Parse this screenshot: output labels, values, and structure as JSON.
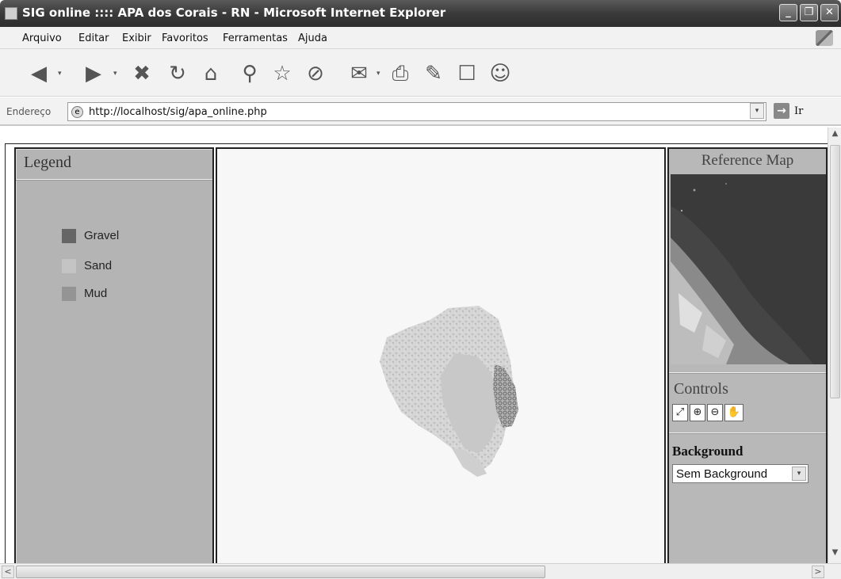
{
  "window": {
    "title": "SIG online :::: APA dos Corais - RN - Microsoft Internet Explorer",
    "minimize": "_",
    "maximize": "❐",
    "close": "✕"
  },
  "menu": [
    "Arquivo",
    "Editar",
    "Exibir",
    "Favoritos",
    "Ferramentas",
    "Ajuda"
  ],
  "toolbar": {
    "icons": [
      "back-icon",
      "forward-icon",
      "stop-icon",
      "refresh-icon",
      "home-icon",
      "search-icon",
      "favorites-icon",
      "history-icon",
      "mail-icon",
      "print-icon",
      "edit-icon",
      "discuss-icon",
      "messenger-icon"
    ],
    "glyphs": [
      "◀",
      "▶",
      "✖",
      "↻",
      "⌂",
      "⚲",
      "☆",
      "⊘",
      "✉",
      "⎙",
      "✎",
      "☐",
      "☺"
    ]
  },
  "address": {
    "label": "Endereço",
    "url": "http://localhost/sig/apa_online.php",
    "go_label": "Ir",
    "dropdown": "▾",
    "go_glyph": "→"
  },
  "legend": {
    "title": "Legend",
    "items": [
      {
        "label": "Gravel",
        "color": "#666666"
      },
      {
        "label": "Sand",
        "color": "#c4c4c4"
      },
      {
        "label": "Mud",
        "color": "#949494"
      }
    ]
  },
  "reference_map": {
    "title": "Reference Map"
  },
  "controls": {
    "title": "Controls",
    "buttons": [
      {
        "icon": "full-extent-icon",
        "glyph": "⤢"
      },
      {
        "icon": "zoom-in-icon",
        "glyph": "⊕"
      },
      {
        "icon": "zoom-out-icon",
        "glyph": "⊖"
      },
      {
        "icon": "pan-hand-icon",
        "glyph": "✋"
      }
    ]
  },
  "background": {
    "title": "Background",
    "selected": "Sem Background",
    "dropdown": "▾"
  },
  "scroll": {
    "up": "▲",
    "down": "▼",
    "left": "<",
    "right": ">"
  }
}
